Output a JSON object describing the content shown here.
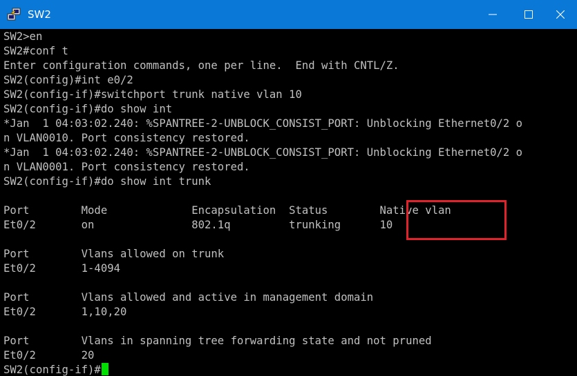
{
  "window": {
    "title": "SW2",
    "accent_color": "#0a78d7",
    "controls": [
      "minimize-icon",
      "maximize-icon",
      "close-icon"
    ]
  },
  "terminal": {
    "text_color": "#c0c0c0",
    "background": "#000000",
    "cursor_color": "#00e000",
    "highlight_color": "#e0232b",
    "lines": [
      "SW2>en",
      "SW2#conf t",
      "Enter configuration commands, one per line.  End with CNTL/Z.",
      "SW2(config)#int e0/2",
      "SW2(config-if)#switchport trunk native vlan 10",
      "SW2(config-if)#do show int",
      "*Jan  1 04:03:02.240: %SPANTREE-2-UNBLOCK_CONSIST_PORT: Unblocking Ethernet0/2 o",
      "n VLAN0010. Port consistency restored.",
      "*Jan  1 04:03:02.240: %SPANTREE-2-UNBLOCK_CONSIST_PORT: Unblocking Ethernet0/2 o",
      "n VLAN0001. Port consistency restored.",
      "SW2(config-if)#do show int trunk",
      "",
      "Port        Mode             Encapsulation  Status        Native vlan",
      "Et0/2       on               802.1q         trunking      10",
      "",
      "Port        Vlans allowed on trunk",
      "Et0/2       1-4094",
      "",
      "Port        Vlans allowed and active in management domain",
      "Et0/2       1,10,20",
      "",
      "Port        Vlans in spanning tree forwarding state and not pruned",
      "Et0/2       20"
    ],
    "prompt": "SW2(config-if)#"
  }
}
